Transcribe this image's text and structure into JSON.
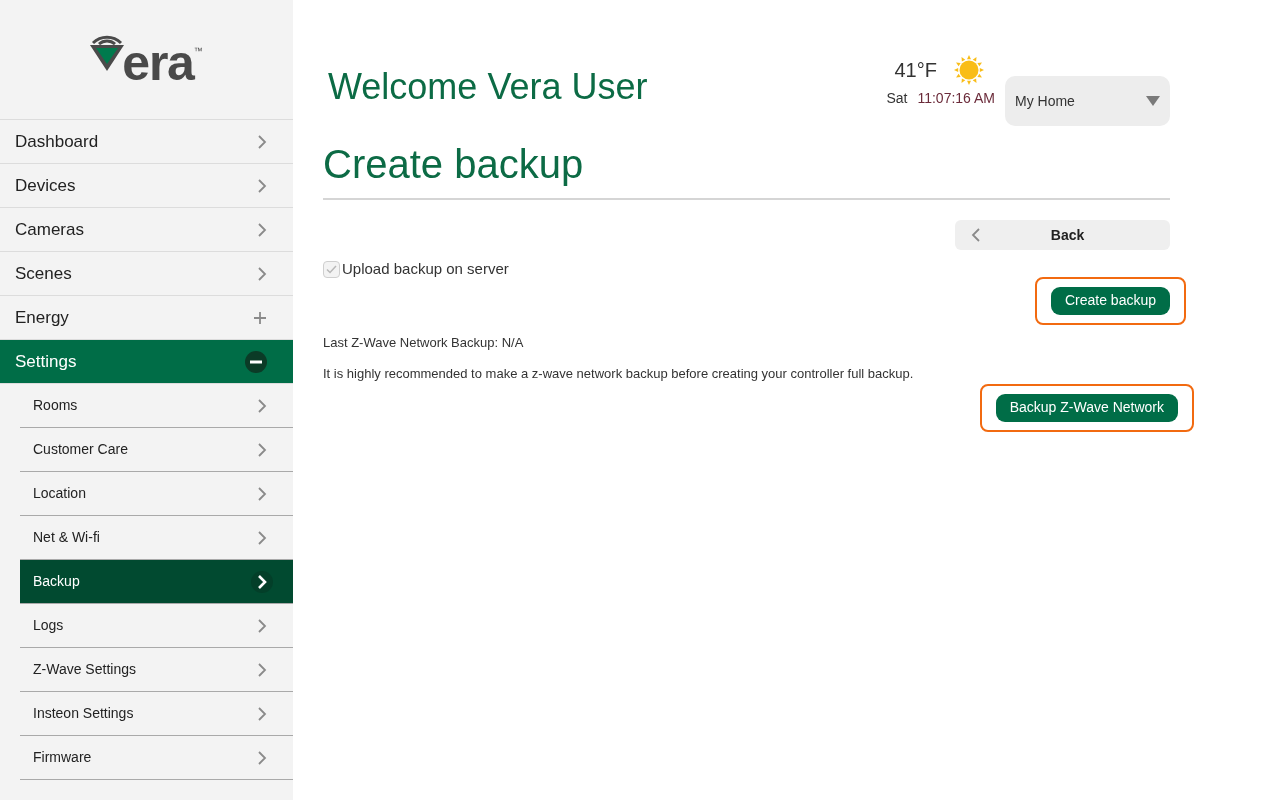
{
  "sidebar": {
    "logo": {
      "wordmark": "era",
      "trademark": "™"
    },
    "items": [
      {
        "label": "Dashboard",
        "kind": "link",
        "selected": false
      },
      {
        "label": "Devices",
        "kind": "link",
        "selected": false
      },
      {
        "label": "Cameras",
        "kind": "link",
        "selected": false
      },
      {
        "label": "Scenes",
        "kind": "link",
        "selected": false
      },
      {
        "label": "Energy",
        "kind": "expandable",
        "expanded": false,
        "selected": false
      },
      {
        "label": "Settings",
        "kind": "expandable",
        "expanded": true,
        "selected": true,
        "children": [
          {
            "label": "Rooms",
            "selected": false
          },
          {
            "label": "Customer Care",
            "selected": false
          },
          {
            "label": "Location",
            "selected": false
          },
          {
            "label": "Net & Wi-fi",
            "selected": false
          },
          {
            "label": "Backup",
            "selected": true
          },
          {
            "label": "Logs",
            "selected": false
          },
          {
            "label": "Z-Wave Settings",
            "selected": false
          },
          {
            "label": "Insteon Settings",
            "selected": false
          },
          {
            "label": "Firmware",
            "selected": false
          }
        ]
      }
    ]
  },
  "header": {
    "welcome": "Welcome Vera User",
    "temperature": "41°F",
    "day": "Sat",
    "time": "11:07:16 AM",
    "home_select": {
      "value": "My Home"
    }
  },
  "page": {
    "title": "Create backup",
    "back_button": "Back",
    "upload_checkbox": {
      "label": "Upload backup on server",
      "checked": true,
      "disabled": true
    },
    "create_button": {
      "label": "Create backup",
      "highlighted": true
    },
    "last_backup": "Last Z-Wave Network Backup: N/A",
    "recommendation": "It is highly recommended to make a z-wave network backup before creating your controller full backup.",
    "zwave_button": {
      "label": "Backup Z-Wave Network",
      "highlighted": true
    }
  }
}
